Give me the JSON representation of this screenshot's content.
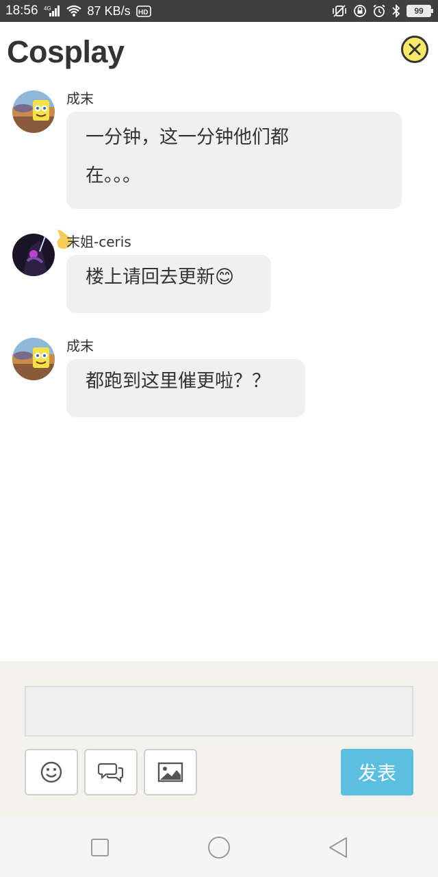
{
  "status_bar": {
    "time": "18:56",
    "network_label": "4G",
    "speed": "87 KB/s",
    "hd_label": "HD",
    "battery": "99"
  },
  "header": {
    "title": "Cosplay"
  },
  "messages": [
    {
      "author": "成末",
      "lines": [
        "一分钟，这一分钟他们都",
        "在。。。"
      ]
    },
    {
      "author": "末姐-ceris",
      "lines": [
        "楼上请回去更新😊"
      ]
    },
    {
      "author": "成末",
      "lines": [
        "都跑到这里催更啦？？"
      ]
    }
  ],
  "composer": {
    "input_value": "",
    "input_placeholder": "",
    "send_label": "发表",
    "tools": [
      "emoji-icon",
      "chat-bubbles-icon",
      "image-icon"
    ]
  },
  "nav": {
    "buttons": [
      "recent-apps-icon",
      "home-icon",
      "back-icon"
    ]
  },
  "colors": {
    "accent": "#5bbfe0",
    "close": "#fbe86b",
    "bubble": "#f0f0f0",
    "composer_bg": "#f3f2ed"
  }
}
